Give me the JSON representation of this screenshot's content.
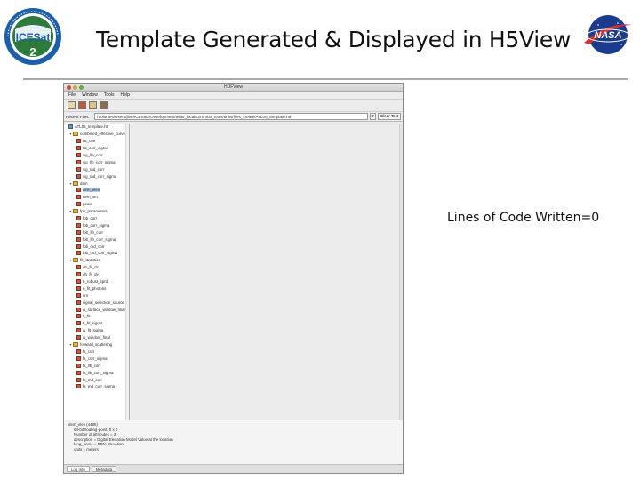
{
  "slide": {
    "title": "Template Generated & Displayed in H5View",
    "note": "Lines of Code Written=0",
    "logos": {
      "left": {
        "name": "icesat-2-logo",
        "text": "ICESat 2",
        "ring_text": "ICE, CLOUD, AND LAND ELEVATION SATELLITE",
        "colors": [
          "#1d5fa8",
          "#2d7a3a",
          "#ffffff"
        ]
      },
      "right": {
        "name": "nasa-meatball-logo",
        "text": "NASA",
        "colors": [
          "#1b3c8c",
          "#d62e2e",
          "#ffffff"
        ]
      }
    }
  },
  "app": {
    "window_title": "HDFView",
    "menu": [
      "File",
      "Window",
      "Tools",
      "Help"
    ],
    "toolbar_icons": [
      "open-file-icon",
      "save-file-icon",
      "image-icon",
      "help-icon"
    ],
    "url_label": "Recent Files",
    "url_value": "/Volumes/Users/jlee/ICESat2/Development/asas_local/common_tools/units/files_create/ATL06_template.h5",
    "clear_text_label": "Clear Text",
    "tree": [
      {
        "level": 0,
        "type": "file",
        "label": "ATL06_template.h5",
        "expander": ""
      },
      {
        "level": 1,
        "type": "group",
        "label": "combined_effective_curve",
        "expander": "▾"
      },
      {
        "level": 2,
        "type": "dataset",
        "label": "lat_corr"
      },
      {
        "level": 2,
        "type": "dataset",
        "label": "lat_corr_sigma"
      },
      {
        "level": 2,
        "type": "dataset",
        "label": "sig_llh_corr"
      },
      {
        "level": 2,
        "type": "dataset",
        "label": "sig_llh_corr_sigma"
      },
      {
        "level": 2,
        "type": "dataset",
        "label": "sig_md_corr"
      },
      {
        "level": 2,
        "type": "dataset",
        "label": "sig_md_corr_sigma"
      },
      {
        "level": 1,
        "type": "group",
        "label": "dem",
        "expander": "▾"
      },
      {
        "level": 2,
        "type": "dataset",
        "label": "dem_elev",
        "selected": true
      },
      {
        "level": 2,
        "type": "dataset",
        "label": "dem_sm"
      },
      {
        "level": 2,
        "type": "dataset",
        "label": "geoid"
      },
      {
        "level": 1,
        "type": "group",
        "label": "fpb_parameters",
        "expander": "▾"
      },
      {
        "level": 2,
        "type": "dataset",
        "label": "fpb_corr"
      },
      {
        "level": 2,
        "type": "dataset",
        "label": "fpb_corr_sigma"
      },
      {
        "level": 2,
        "type": "dataset",
        "label": "fpb_llh_corr"
      },
      {
        "level": 2,
        "type": "dataset",
        "label": "fpb_llh_corr_sigma"
      },
      {
        "level": 2,
        "type": "dataset",
        "label": "fpb_md_corr"
      },
      {
        "level": 2,
        "type": "dataset",
        "label": "fpb_md_corr_sigma"
      },
      {
        "level": 1,
        "type": "group",
        "label": "fit_statistics",
        "expander": "▾"
      },
      {
        "level": 2,
        "type": "dataset",
        "label": "dh_fit_dx"
      },
      {
        "level": 2,
        "type": "dataset",
        "label": "dh_fit_dy"
      },
      {
        "level": 2,
        "type": "dataset",
        "label": "h_robust_sprd"
      },
      {
        "level": 2,
        "type": "dataset",
        "label": "n_fit_photons"
      },
      {
        "level": 2,
        "type": "dataset",
        "label": "snr"
      },
      {
        "level": 2,
        "type": "dataset",
        "label": "signal_selection_source"
      },
      {
        "level": 2,
        "type": "dataset",
        "label": "w_surface_window_final"
      },
      {
        "level": 2,
        "type": "dataset",
        "label": "h_fit"
      },
      {
        "level": 2,
        "type": "dataset",
        "label": "h_fit_sigma"
      },
      {
        "level": 2,
        "type": "dataset",
        "label": "w_fit_sigma"
      },
      {
        "level": 2,
        "type": "dataset",
        "label": "w_window_final"
      },
      {
        "level": 1,
        "type": "group",
        "label": "forward_scattering",
        "expander": "▾"
      },
      {
        "level": 2,
        "type": "dataset",
        "label": "fs_corr"
      },
      {
        "level": 2,
        "type": "dataset",
        "label": "fs_corr_sigma"
      },
      {
        "level": 2,
        "type": "dataset",
        "label": "fs_llh_corr"
      },
      {
        "level": 2,
        "type": "dataset",
        "label": "fs_llh_corr_sigma"
      },
      {
        "level": 2,
        "type": "dataset",
        "label": "fs_md_corr"
      },
      {
        "level": 2,
        "type": "dataset",
        "label": "fs_md_corr_sigma"
      }
    ],
    "info": [
      {
        "text": "dem_elev (4485)",
        "indent": false
      },
      {
        "text": "64-bit floating-point, 0 x 0",
        "indent": true
      },
      {
        "text": "Number of attributes = 3",
        "indent": true
      },
      {
        "text": "description = Digital Elevation Model Value at the location",
        "indent": true
      },
      {
        "text": "long_name = DEM Elevation",
        "indent": true
      },
      {
        "text": "units = meters",
        "indent": true
      }
    ],
    "info_tabs": [
      {
        "label": "Log Info",
        "active": true
      },
      {
        "label": "Metadata",
        "active": false
      }
    ]
  }
}
